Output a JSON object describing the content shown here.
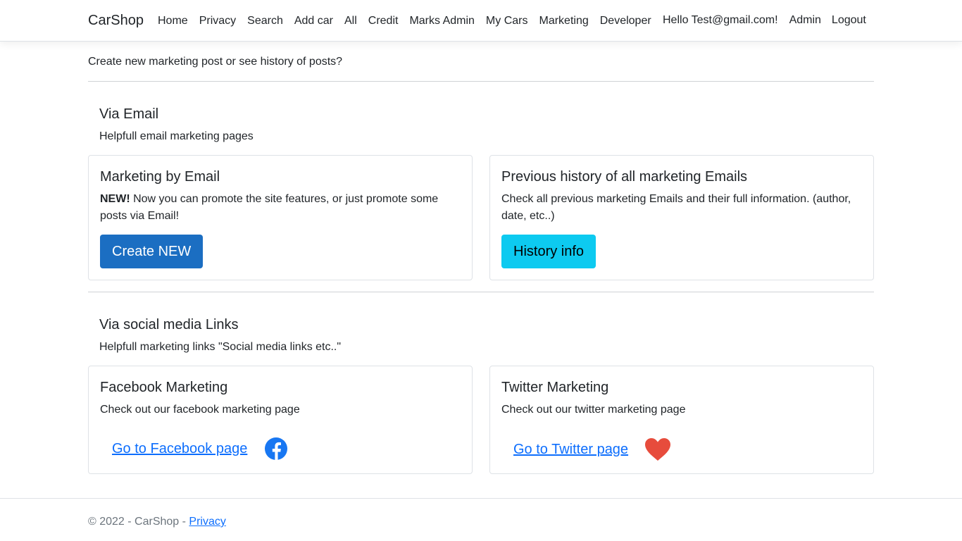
{
  "navbar": {
    "brand": "CarShop",
    "items": [
      "Home",
      "Privacy",
      "Search",
      "Add car",
      "All",
      "Credit",
      "Marks Admin",
      "My Cars",
      "Marketing",
      "Developer"
    ],
    "greeting": "Hello Test@gmail.com!",
    "admin": "Admin",
    "logout": "Logout"
  },
  "intro": "Create new marketing post or see history of posts?",
  "email_section": {
    "title": "Via Email",
    "subtitle": "Helpfull email marketing pages",
    "card1": {
      "title": "Marketing by Email",
      "bold": "NEW!",
      "text": " Now you can promote the site features, or just promote some posts via Email!",
      "button": "Create NEW"
    },
    "card2": {
      "title": "Previous history of all marketing Emails",
      "text": "Check all previous marketing Emails and their full information. (author, date, etc..)",
      "button": "History info"
    }
  },
  "social_section": {
    "title": "Via social media Links",
    "subtitle": "Helpfull marketing links \"Social media links etc..\"",
    "card1": {
      "title": "Facebook Marketing",
      "text": "Check out our facebook marketing page",
      "link": "Go to Facebook page",
      "icon": "facebook-icon"
    },
    "card2": {
      "title": "Twitter Marketing",
      "text": "Check out our twitter marketing page",
      "link": "Go to Twitter page",
      "icon": "heart-icon"
    }
  },
  "footer": {
    "copyright": "© 2022 - CarShop - ",
    "privacy": "Privacy"
  },
  "colors": {
    "primary": "#1b6ec2",
    "info": "#0dcaf0",
    "link": "#0d6efd",
    "facebook": "#1877f2",
    "heart": "#e74c3c"
  }
}
